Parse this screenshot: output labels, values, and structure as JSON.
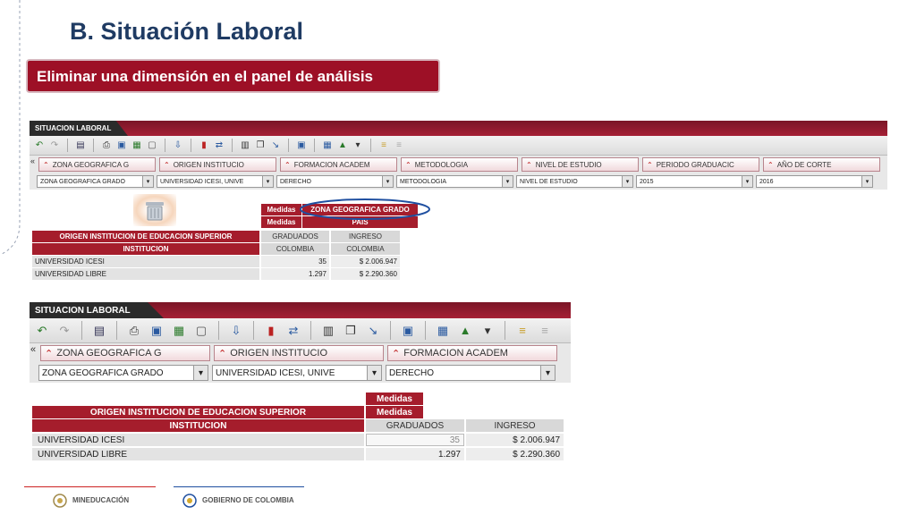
{
  "slide": {
    "title": "B. Situación Laboral",
    "subtitle": "Eliminar una dimensión en el panel de análisis"
  },
  "panel_top": {
    "title": "SITUACION LABORAL",
    "dimensions": [
      {
        "label": "ZONA GEOGRAFICA G",
        "value": "ZONA GEOGRAFICA GRADO"
      },
      {
        "label": "ORIGEN INSTITUCIO",
        "value": "UNIVERSIDAD ICESI, UNIVE"
      },
      {
        "label": "FORMACION ACADEM",
        "value": "DERECHO"
      },
      {
        "label": "METODOLOGIA",
        "value": "METODOLOGIA"
      },
      {
        "label": "NIVEL DE ESTUDIO",
        "value": "NIVEL DE ESTUDIO"
      },
      {
        "label": "PERIODO GRADUACIC",
        "value": "2015"
      },
      {
        "label": "AÑO DE CORTE",
        "value": "2016"
      }
    ],
    "table": {
      "medidas_label": "Medidas",
      "dragged_dim": "ZONA GEOGRAFICA GRADO",
      "pais": "PAIS",
      "row_header_1": "ORIGEN INSTITUCION DE EDUCACION SUPERIOR",
      "row_header_2": "INSTITUCION",
      "col_measures": [
        "GRADUADOS",
        "INGRESO"
      ],
      "col_country": [
        "COLOMBIA",
        "COLOMBIA"
      ],
      "rows": [
        {
          "name": "UNIVERSIDAD ICESI",
          "graduados": "35",
          "ingreso": "$ 2.006.947"
        },
        {
          "name": "UNIVERSIDAD LIBRE",
          "graduados": "1.297",
          "ingreso": "$ 2.290.360"
        }
      ]
    }
  },
  "panel_bottom": {
    "title": "SITUACION LABORAL",
    "dimensions": [
      {
        "label": "ZONA GEOGRAFICA G",
        "value": "ZONA GEOGRAFICA GRADO"
      },
      {
        "label": "ORIGEN INSTITUCIO",
        "value": "UNIVERSIDAD ICESI, UNIVE"
      },
      {
        "label": "FORMACION ACADEM",
        "value": "DERECHO"
      }
    ],
    "table": {
      "medidas_1": "Medidas",
      "medidas_2": "Medidas",
      "row_header_1": "ORIGEN INSTITUCION DE EDUCACION SUPERIOR",
      "row_header_2": "INSTITUCION",
      "col_measures": [
        "GRADUADOS",
        "INGRESO"
      ],
      "rows": [
        {
          "name": "UNIVERSIDAD ICESI",
          "graduados": "35",
          "ingreso": "$ 2.006.947"
        },
        {
          "name": "UNIVERSIDAD LIBRE",
          "graduados": "1.297",
          "ingreso": "$ 2.290.360"
        }
      ]
    }
  },
  "footer": {
    "logo1": "MINEDUCACIÓN",
    "logo2": "GOBIERNO DE COLOMBIA"
  },
  "colors": {
    "title_blue": "#1f3b63",
    "accent_red": "#9d1026",
    "highlight_blue": "#1f4fa0"
  }
}
